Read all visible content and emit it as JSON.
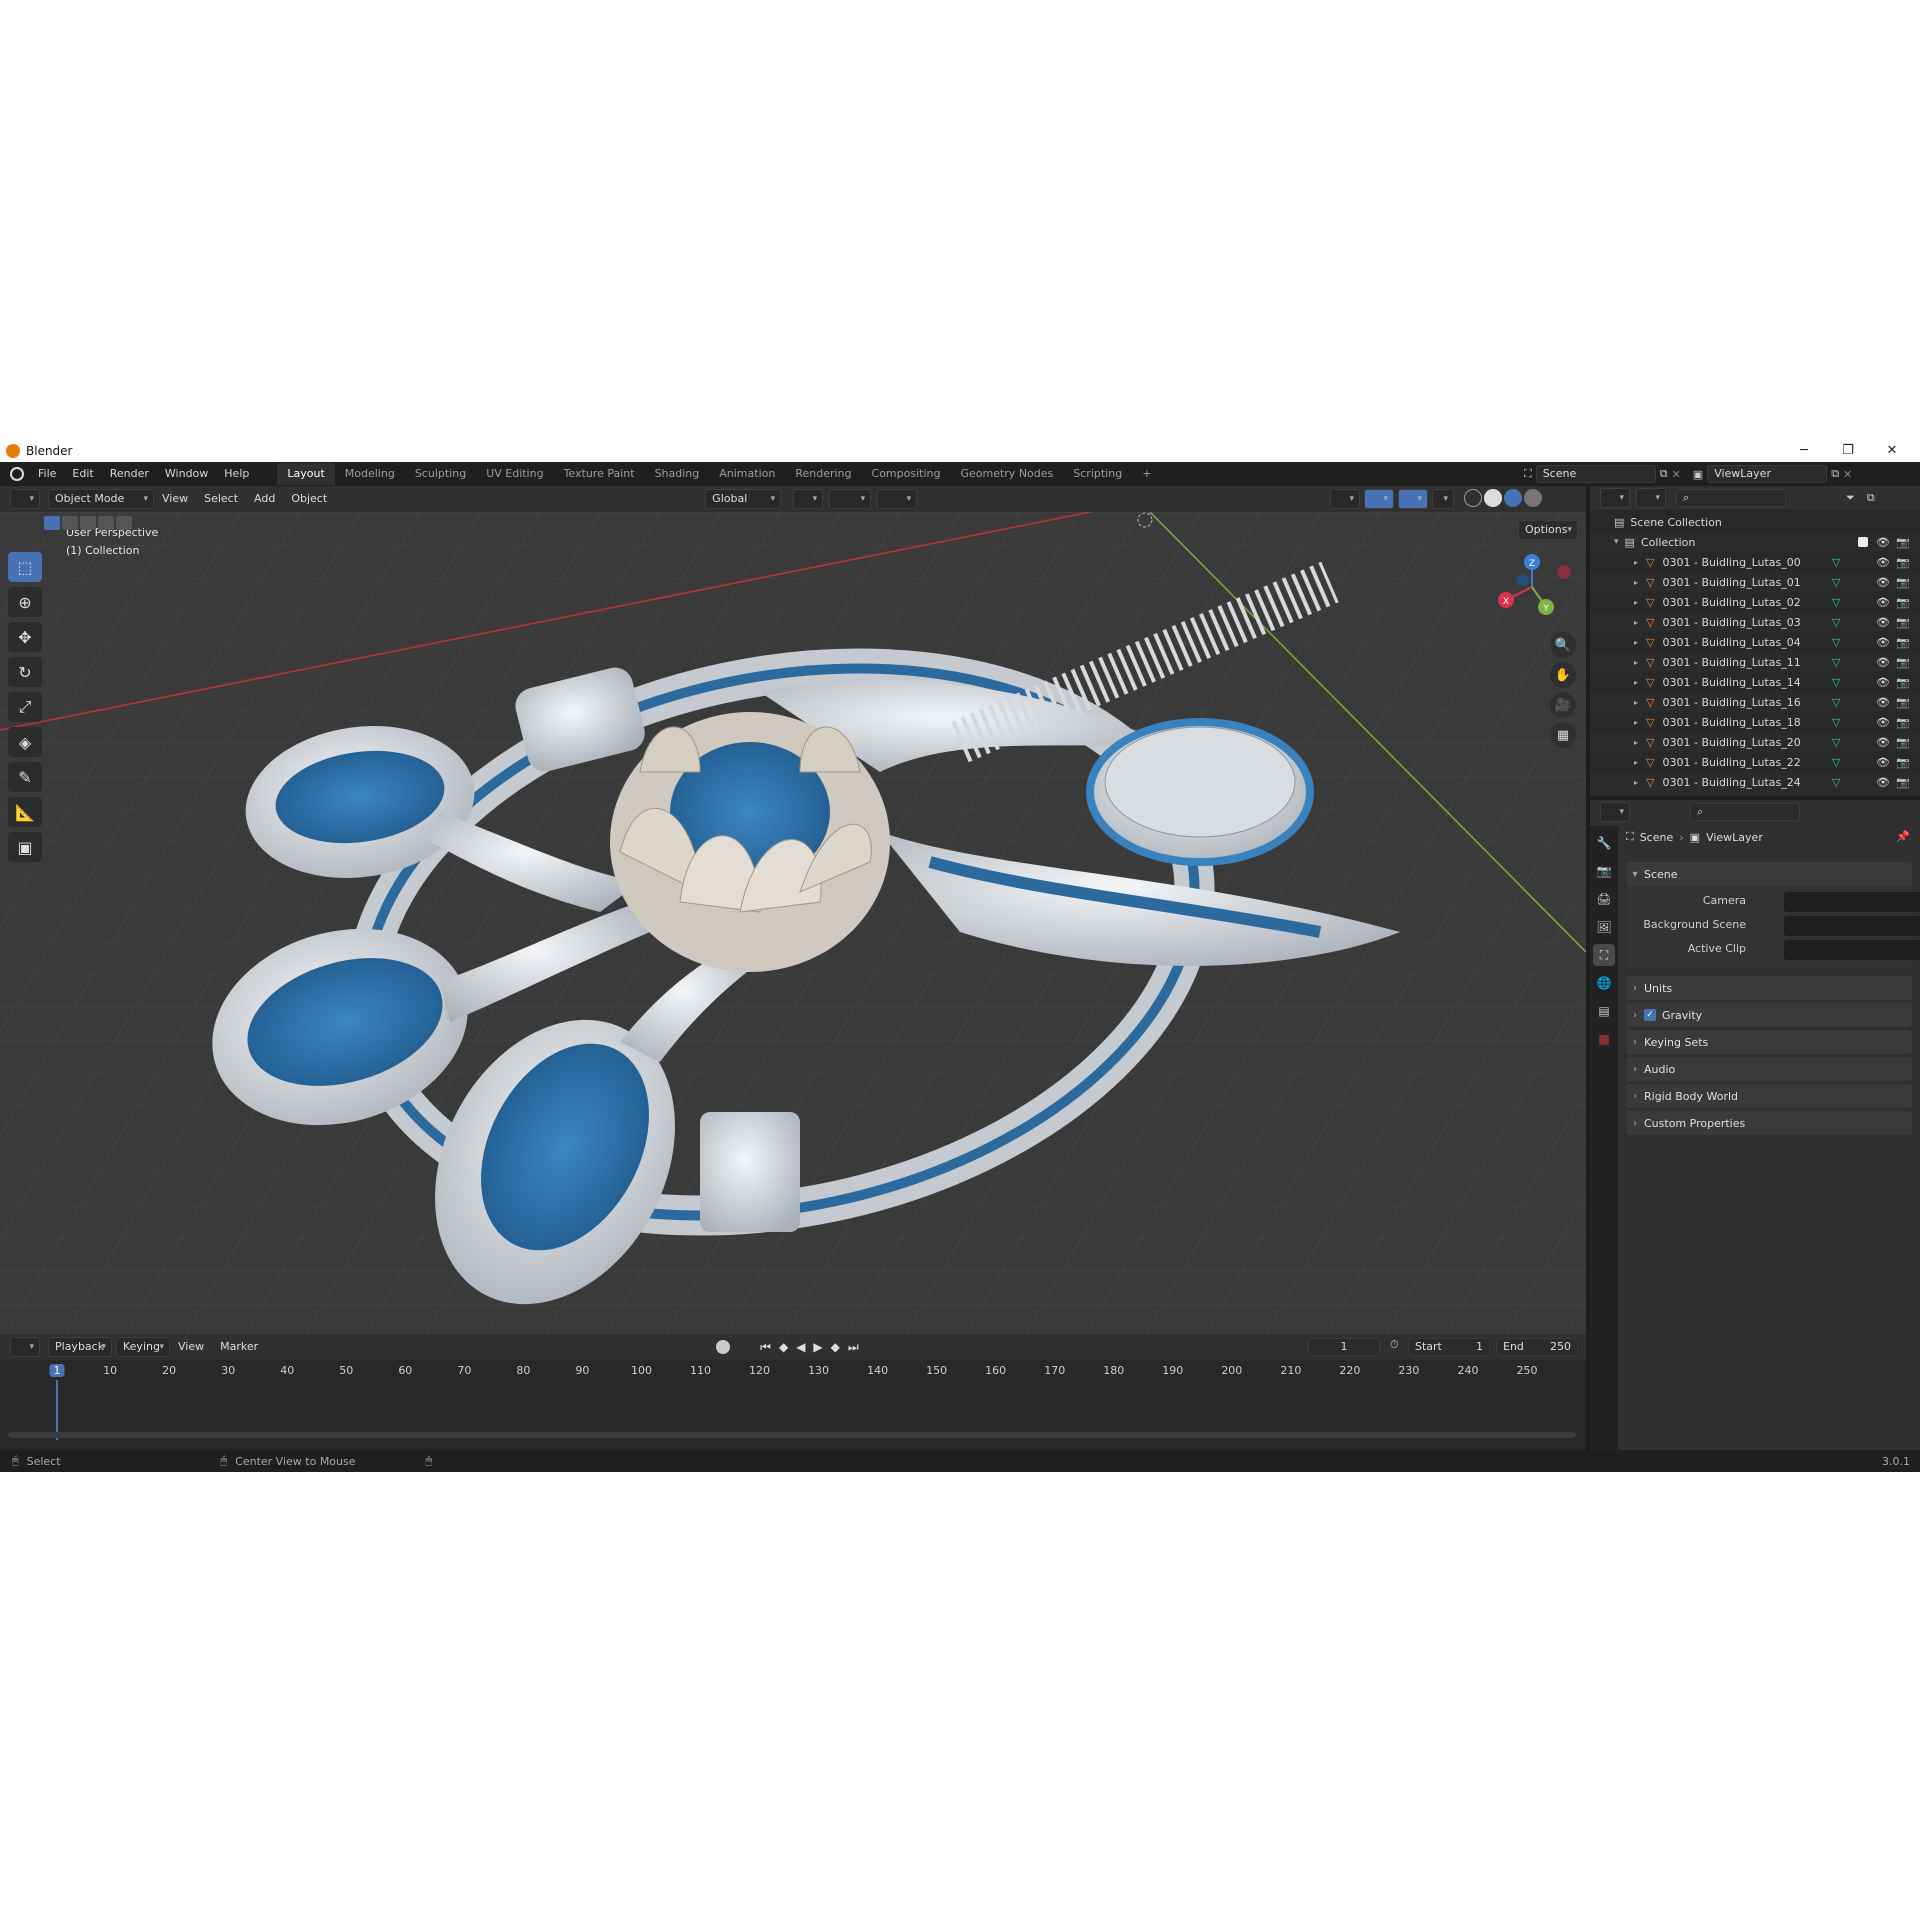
{
  "window": {
    "title": "Blender",
    "minimize": "─",
    "maximize": "❐",
    "close": "✕"
  },
  "menu": [
    "File",
    "Edit",
    "Render",
    "Window",
    "Help"
  ],
  "workspaces": [
    "Layout",
    "Modeling",
    "Sculpting",
    "UV Editing",
    "Texture Paint",
    "Shading",
    "Animation",
    "Rendering",
    "Compositing",
    "Geometry Nodes",
    "Scripting"
  ],
  "active_workspace": "Layout",
  "add_workspace": "+",
  "scene_field": "Scene",
  "viewlayer_field": "ViewLayer",
  "viewport_header": {
    "mode": "Object Mode",
    "menus": [
      "View",
      "Select",
      "Add",
      "Object"
    ],
    "orientation": "Global",
    "options": "Options"
  },
  "viewport": {
    "perspective": "User Perspective",
    "collection": "(1) Collection",
    "axis_x": "X",
    "axis_y": "Y",
    "axis_z": "Z"
  },
  "outliner": {
    "root": "Scene Collection",
    "collection": "Collection",
    "items": [
      "0301 - Buidling_Lutas_00",
      "0301 - Buidling_Lutas_01",
      "0301 - Buidling_Lutas_02",
      "0301 - Buidling_Lutas_03",
      "0301 - Buidling_Lutas_04",
      "0301 - Buidling_Lutas_11",
      "0301 - Buidling_Lutas_14",
      "0301 - Buidling_Lutas_16",
      "0301 - Buidling_Lutas_18",
      "0301 - Buidling_Lutas_20",
      "0301 - Buidling_Lutas_22",
      "0301 - Buidling_Lutas_24"
    ]
  },
  "properties": {
    "breadcrumb_scene": "Scene",
    "breadcrumb_viewlayer": "ViewLayer",
    "panel_scene": "Scene",
    "camera_label": "Camera",
    "background_label": "Background Scene",
    "clip_label": "Active Clip",
    "panels": [
      "Units",
      "Gravity",
      "Keying Sets",
      "Audio",
      "Rigid Body World",
      "Custom Properties"
    ],
    "gravity_checked": true
  },
  "timeline": {
    "menus": [
      "Playback",
      "Keying",
      "View",
      "Marker"
    ],
    "current_frame": "1",
    "start_label": "Start",
    "start_value": "1",
    "end_label": "End",
    "end_value": "250",
    "ticks": [
      "1",
      "10",
      "20",
      "30",
      "40",
      "50",
      "60",
      "70",
      "80",
      "90",
      "100",
      "110",
      "120",
      "130",
      "140",
      "150",
      "160",
      "170",
      "180",
      "190",
      "200",
      "210",
      "220",
      "230",
      "240",
      "250"
    ]
  },
  "statusbar": {
    "select": "Select",
    "center": "Center View to Mouse",
    "version": "3.0.1"
  },
  "colors": {
    "accent": "#4772b3",
    "x_axis": "#d9334d",
    "y_axis": "#7cb342",
    "z_axis": "#3d7fd6",
    "glass": "#2f6c9e"
  }
}
